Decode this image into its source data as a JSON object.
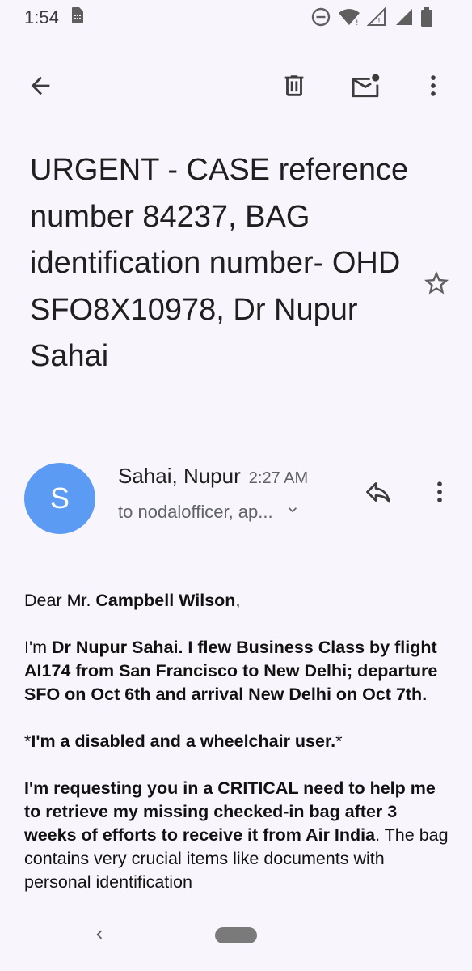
{
  "status_bar": {
    "time": "1:54"
  },
  "subject": "URGENT - CASE reference number 84237, BAG identification number- OHD SFO8X10978, Dr Nupur Sahai",
  "message": {
    "avatar_letter": "S",
    "sender": "Sahai, Nupur",
    "time": "2:27 AM",
    "recipients": "to nodalofficer, ap..."
  },
  "body": {
    "p1_a": "Dear Mr. ",
    "p1_b": "Campbell Wilson",
    "p1_c": ",",
    "p2_a": "I'm ",
    "p2_b": "Dr Nupur Sahai. I flew Business Class by flight AI174 from San Francisco to New Delhi; departure SFO on Oct 6th and arrival New Delhi on Oct 7th.",
    "p3_a": "*",
    "p3_b": "I'm a disabled and a wheelchair user.",
    "p3_c": "*",
    "p4_a": "I'm requesting you in a CRITICAL need to help me to retrieve my missing checked-in bag after 3 weeks of efforts to receive it from Air India",
    "p4_b": ". The bag contains very crucial items like documents with personal identification"
  },
  "icons": {
    "back": "arrow-back-icon",
    "delete": "trash-icon",
    "mark_unread": "mail-unread-icon",
    "more": "more-vert-icon",
    "star": "star-outline-icon",
    "reply": "reply-icon",
    "expand": "chevron-down-icon"
  }
}
